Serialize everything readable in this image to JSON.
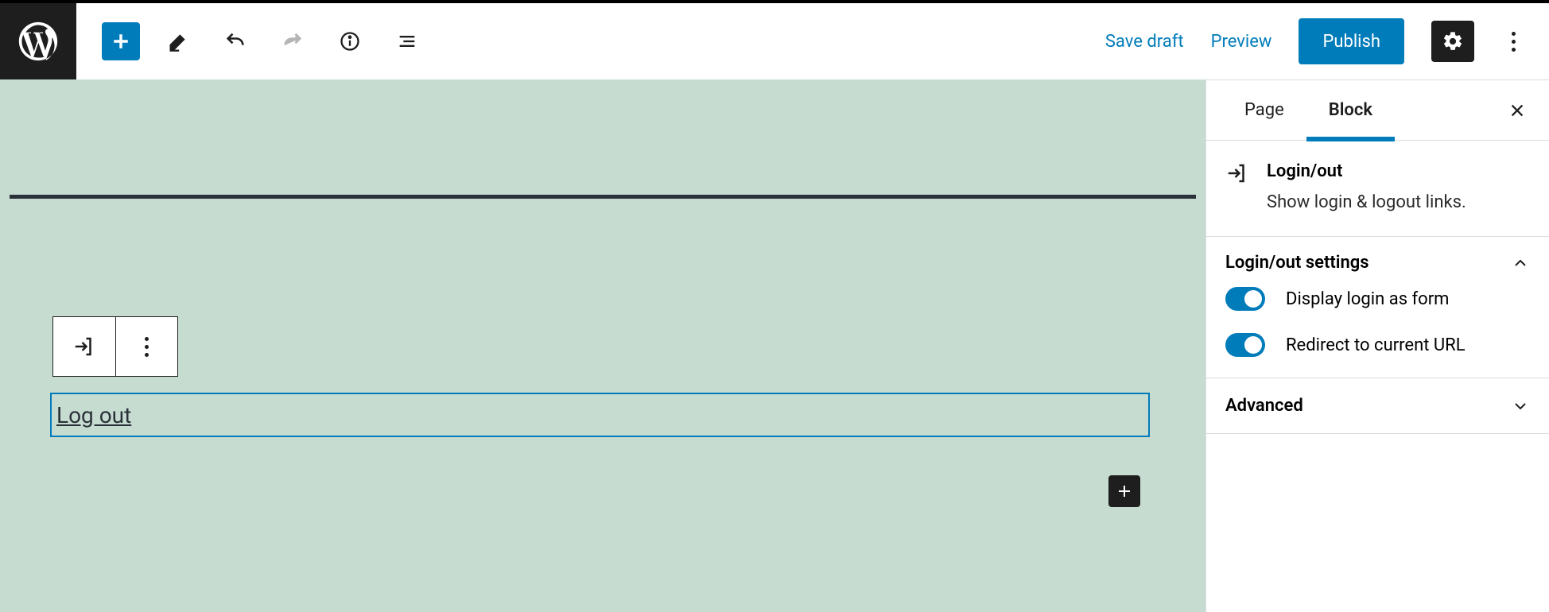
{
  "topbar": {
    "save_draft": "Save draft",
    "preview": "Preview",
    "publish": "Publish"
  },
  "canvas": {
    "block_link_text": "Log out"
  },
  "sidebar": {
    "tabs": {
      "page": "Page",
      "block": "Block"
    },
    "block_info": {
      "title": "Login/out",
      "description": "Show login & logout links."
    },
    "panels": {
      "settings": {
        "title": "Login/out settings",
        "toggles": {
          "display_form": "Display login as form",
          "redirect": "Redirect to current URL"
        }
      },
      "advanced": {
        "title": "Advanced"
      }
    }
  }
}
